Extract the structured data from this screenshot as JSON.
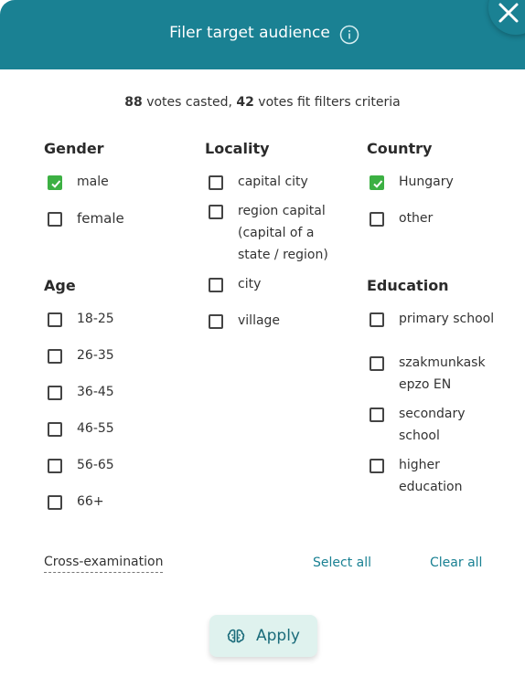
{
  "header": {
    "title": "Filer target audience"
  },
  "summary": {
    "votes": "88",
    "votes_text": " votes casted, ",
    "fit": "42",
    "fit_text": " votes fit filters criteria"
  },
  "gender": {
    "title": "Gender",
    "options": [
      {
        "label": "male",
        "checked": true
      },
      {
        "label": "female",
        "checked": false
      }
    ]
  },
  "age": {
    "title": "Age",
    "options": [
      {
        "label": "18-25",
        "checked": false
      },
      {
        "label": "26-35",
        "checked": false
      },
      {
        "label": "36-45",
        "checked": false
      },
      {
        "label": "46-55",
        "checked": false
      },
      {
        "label": "56-65",
        "checked": false
      },
      {
        "label": "66+",
        "checked": false
      }
    ]
  },
  "locality": {
    "title": "Locality",
    "options": [
      {
        "label": "capital city",
        "checked": false
      },
      {
        "label": "region capital (capital of a state / region)",
        "checked": false
      },
      {
        "label": "city",
        "checked": false
      },
      {
        "label": "village",
        "checked": false
      }
    ]
  },
  "country": {
    "title": "Country",
    "options": [
      {
        "label": "Hungary",
        "checked": true
      },
      {
        "label": "other",
        "checked": false
      }
    ]
  },
  "education": {
    "title": "Education",
    "options": [
      {
        "label": "primary school",
        "checked": false
      },
      {
        "label": "szakmunkaskepzo EN",
        "checked": false
      },
      {
        "label": "secondary school",
        "checked": false
      },
      {
        "label": "higher education",
        "checked": false
      }
    ]
  },
  "footer": {
    "cross_examination": "Cross-examination",
    "select_all": "Select all",
    "clear_all": "Clear all",
    "apply": "Apply"
  },
  "colors": {
    "accent": "#1a8193",
    "check": "#3cb043",
    "apply_bg": "#dff2ee"
  }
}
